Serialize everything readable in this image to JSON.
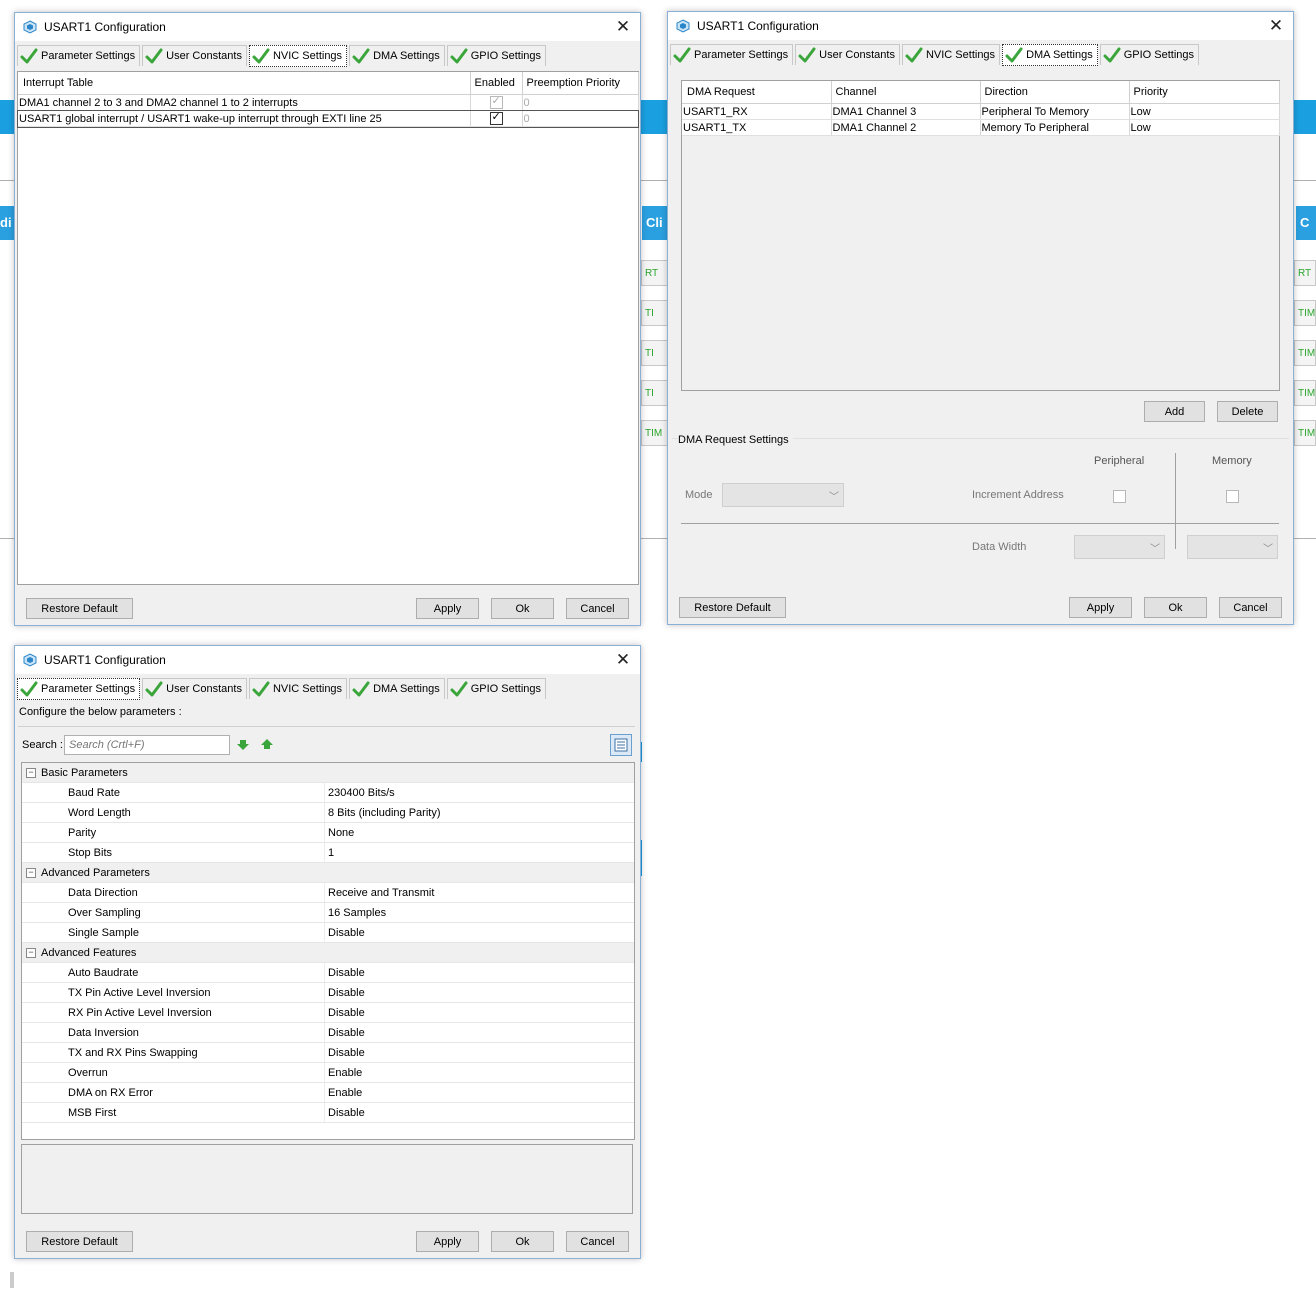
{
  "nvic_dialog": {
    "title": "USART1 Configuration",
    "tabs": [
      {
        "label": "Parameter Settings"
      },
      {
        "label": "User Constants"
      },
      {
        "label": "NVIC Settings"
      },
      {
        "label": "DMA Settings"
      },
      {
        "label": "GPIO Settings"
      }
    ],
    "active_tab": "NVIC Settings",
    "table": {
      "headers": [
        "Interrupt Table",
        "Enabled",
        "Preemption Priority"
      ],
      "rows": [
        {
          "name": "DMA1 channel 2 to 3 and DMA2 channel 1 to 2 interrupts",
          "enabled": true,
          "enabled_disabled": true,
          "priority": "0"
        },
        {
          "name": "USART1 global interrupt / USART1 wake-up interrupt through EXTI line 25",
          "enabled": true,
          "enabled_disabled": false,
          "priority": "0"
        }
      ]
    },
    "buttons": {
      "restore": "Restore Default",
      "apply": "Apply",
      "ok": "Ok",
      "cancel": "Cancel"
    }
  },
  "dma_dialog": {
    "title": "USART1 Configuration",
    "tabs": [
      {
        "label": "Parameter Settings"
      },
      {
        "label": "User Constants"
      },
      {
        "label": "NVIC Settings"
      },
      {
        "label": "DMA Settings"
      },
      {
        "label": "GPIO Settings"
      }
    ],
    "active_tab": "DMA Settings",
    "table": {
      "headers": [
        "DMA Request",
        "Channel",
        "Direction",
        "Priority"
      ],
      "rows": [
        {
          "request": "USART1_RX",
          "channel": "DMA1 Channel 3",
          "direction": "Peripheral To Memory",
          "priority": "Low"
        },
        {
          "request": "USART1_TX",
          "channel": "DMA1 Channel 2",
          "direction": "Memory To Peripheral",
          "priority": "Low"
        }
      ]
    },
    "add_label": "Add",
    "delete_label": "Delete",
    "request_settings": {
      "title": "DMA Request Settings",
      "peripheral_label": "Peripheral",
      "memory_label": "Memory",
      "mode_label": "Mode",
      "increment_label": "Increment Address",
      "data_width_label": "Data Width"
    },
    "buttons": {
      "restore": "Restore Default",
      "apply": "Apply",
      "ok": "Ok",
      "cancel": "Cancel"
    }
  },
  "param_dialog": {
    "title": "USART1 Configuration",
    "tabs": [
      {
        "label": "Parameter Settings"
      },
      {
        "label": "User Constants"
      },
      {
        "label": "NVIC Settings"
      },
      {
        "label": "DMA Settings"
      },
      {
        "label": "GPIO Settings"
      }
    ],
    "active_tab": "Parameter Settings",
    "intro": "Configure the below parameters :",
    "search_label": "Search :",
    "search_placeholder": "Search (Crtl+F)",
    "groups": [
      {
        "name": "Basic Parameters",
        "params": [
          {
            "name": "Baud Rate",
            "value": "230400 Bits/s"
          },
          {
            "name": "Word Length",
            "value": "8 Bits (including Parity)"
          },
          {
            "name": "Parity",
            "value": "None"
          },
          {
            "name": "Stop Bits",
            "value": "1"
          }
        ]
      },
      {
        "name": "Advanced Parameters",
        "params": [
          {
            "name": "Data Direction",
            "value": "Receive and Transmit"
          },
          {
            "name": "Over Sampling",
            "value": "16 Samples"
          },
          {
            "name": "Single Sample",
            "value": "Disable"
          }
        ]
      },
      {
        "name": "Advanced Features",
        "params": [
          {
            "name": "Auto Baudrate",
            "value": "Disable"
          },
          {
            "name": "TX Pin Active Level Inversion",
            "value": "Disable"
          },
          {
            "name": "RX Pin Active Level Inversion",
            "value": "Disable"
          },
          {
            "name": "Data Inversion",
            "value": "Disable"
          },
          {
            "name": "TX and RX Pins Swapping",
            "value": "Disable"
          },
          {
            "name": "Overrun",
            "value": "Enable"
          },
          {
            "name": "DMA on RX Error",
            "value": "Enable"
          },
          {
            "name": "MSB First",
            "value": "Disable"
          }
        ]
      }
    ],
    "buttons": {
      "restore": "Restore Default",
      "apply": "Apply",
      "ok": "Ok",
      "cancel": "Cancel"
    }
  },
  "background": {
    "left_tab_text": "di",
    "mid_tab_text": "Cli",
    "right_tab_text": "C",
    "mid_items": [
      "RT",
      "TI",
      "TI",
      "TI",
      "TIM"
    ],
    "right_items": [
      "RT",
      "TIM",
      "TIM",
      "TIM",
      "TIM"
    ]
  },
  "colors": {
    "accent": "#1aa0e0",
    "check_green": "#3aa53a",
    "dialog_bg": "#f0f0f0"
  }
}
